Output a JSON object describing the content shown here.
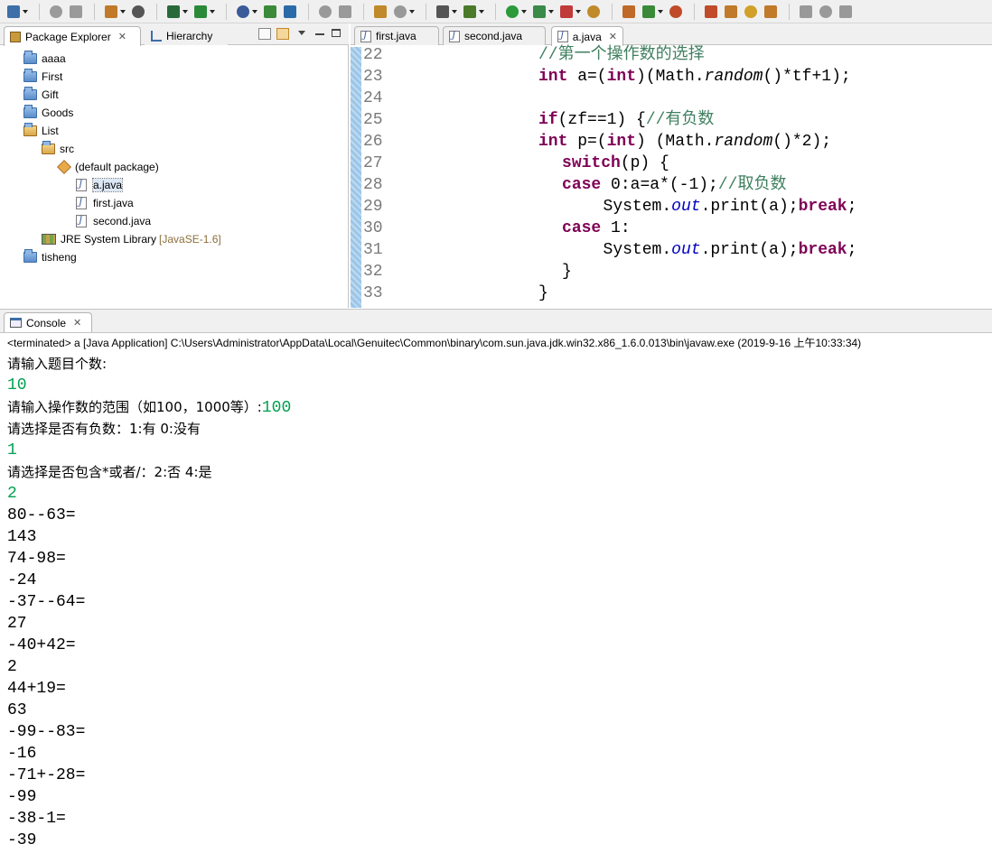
{
  "toolbar": {
    "icons": [
      "new-icon",
      "save-icon",
      "print-icon",
      "tools-icon",
      "access-icon",
      "debug-tool-icon",
      "run-tool-icon",
      "server-icon",
      "deploy-icon",
      "globe-icon",
      "back-icon",
      "fwd-icon",
      "hierarchy-icon",
      "open-icon",
      "camera-icon",
      "bug-icon",
      "run-icon",
      "coverage-icon",
      "external-icon",
      "edit-icon",
      "team-icon",
      "refresh-icon",
      "ant-icon",
      "db-icon",
      "db2-icon",
      "wand-icon",
      "link-icon",
      "pin-icon",
      "min-icon",
      "max-icon"
    ]
  },
  "package_explorer": {
    "tab_label": "Package Explorer",
    "hierarchy_label": "Hierarchy",
    "items": [
      {
        "label": "aaaa",
        "type": "folder",
        "level": 0
      },
      {
        "label": "First",
        "type": "folder",
        "level": 0
      },
      {
        "label": "Gift",
        "type": "folder",
        "level": 0
      },
      {
        "label": "Goods",
        "type": "folder",
        "level": 0
      },
      {
        "label": "List",
        "type": "project",
        "level": 0
      },
      {
        "label": "src",
        "type": "pkgfolder",
        "level": 1
      },
      {
        "label": "(default package)",
        "type": "package",
        "level": 2
      },
      {
        "label": "a.java",
        "type": "java",
        "level": 3,
        "selected": true
      },
      {
        "label": "first.java",
        "type": "java",
        "level": 3
      },
      {
        "label": "second.java",
        "type": "java",
        "level": 3
      },
      {
        "label": "JRE System Library",
        "suffix": "[JavaSE-1.6]",
        "type": "lib",
        "level": 1
      },
      {
        "label": "tisheng",
        "type": "folder",
        "level": 0
      }
    ]
  },
  "editor": {
    "tabs": [
      {
        "label": "first.java",
        "active": false
      },
      {
        "label": "second.java",
        "active": false
      },
      {
        "label": "a.java",
        "active": true
      }
    ],
    "lines": [
      {
        "n": "22",
        "indent": 12,
        "parts": [
          {
            "t": "//第一个操作数的选择",
            "c": "cm"
          }
        ]
      },
      {
        "n": "23",
        "indent": 12,
        "parts": [
          {
            "t": "int",
            "c": "kw"
          },
          {
            "t": " a=("
          },
          {
            "t": "int",
            "c": "kw"
          },
          {
            "t": ")(Math."
          },
          {
            "t": "random",
            "c": "it"
          },
          {
            "t": "()*tf+1);"
          }
        ]
      },
      {
        "n": "24",
        "indent": 0,
        "parts": []
      },
      {
        "n": "25",
        "indent": 12,
        "parts": [
          {
            "t": "if",
            "c": "kw"
          },
          {
            "t": "(zf==1) {"
          },
          {
            "t": "//有负数",
            "c": "cm"
          }
        ]
      },
      {
        "n": "26",
        "indent": 12,
        "parts": [
          {
            "t": "int",
            "c": "kw"
          },
          {
            "t": " p=("
          },
          {
            "t": "int",
            "c": "kw"
          },
          {
            "t": ") (Math."
          },
          {
            "t": "random",
            "c": "it"
          },
          {
            "t": "()*2);"
          }
        ]
      },
      {
        "n": "27",
        "indent": 16,
        "parts": [
          {
            "t": "switch",
            "c": "kw"
          },
          {
            "t": "(p) {"
          }
        ]
      },
      {
        "n": "28",
        "indent": 16,
        "parts": [
          {
            "t": "case",
            "c": "kw"
          },
          {
            "t": " 0:a=a*(-1);"
          },
          {
            "t": "//取负数",
            "c": "cm"
          }
        ]
      },
      {
        "n": "29",
        "indent": 23,
        "parts": [
          {
            "t": "System."
          },
          {
            "t": "out",
            "c": "fld2"
          },
          {
            "t": ".print(a);"
          },
          {
            "t": "break",
            "c": "kw"
          },
          {
            "t": ";"
          }
        ]
      },
      {
        "n": "30",
        "indent": 16,
        "parts": [
          {
            "t": "case",
            "c": "kw"
          },
          {
            "t": " 1:"
          }
        ]
      },
      {
        "n": "31",
        "indent": 23,
        "parts": [
          {
            "t": "System."
          },
          {
            "t": "out",
            "c": "fld2"
          },
          {
            "t": ".print(a);"
          },
          {
            "t": "break",
            "c": "kw"
          },
          {
            "t": ";"
          }
        ]
      },
      {
        "n": "32",
        "indent": 16,
        "parts": [
          {
            "t": "}"
          }
        ]
      },
      {
        "n": "33",
        "indent": 12,
        "parts": [
          {
            "t": "}"
          }
        ]
      }
    ]
  },
  "console": {
    "tab_label": "Console",
    "status": "<terminated> a [Java Application] C:\\Users\\Administrator\\AppData\\Local\\Genuitec\\Common\\binary\\com.sun.java.jdk.win32.x86_1.6.0.013\\bin\\javaw.exe (2019-9-16 上午10:33:34)",
    "lines": [
      [
        {
          "t": "请输入题目个数:"
        }
      ],
      [
        {
          "t": "10",
          "c": "in"
        }
      ],
      [
        {
          "t": "请输入操作数的范围（如100，1000等）:"
        },
        {
          "t": "100",
          "c": "in"
        }
      ],
      [
        {
          "t": "请选择是否有负数：1:有 0:没有"
        }
      ],
      [
        {
          "t": "1",
          "c": "in"
        }
      ],
      [
        {
          "t": "请选择是否包含*或者/：2:否 4:是"
        }
      ],
      [
        {
          "t": "2",
          "c": "in"
        }
      ],
      [
        {
          "t": "80--63="
        }
      ],
      [
        {
          "t": "143"
        }
      ],
      [
        {
          "t": "74-98="
        }
      ],
      [
        {
          "t": "-24"
        }
      ],
      [
        {
          "t": "-37--64="
        }
      ],
      [
        {
          "t": "27"
        }
      ],
      [
        {
          "t": "-40+42="
        }
      ],
      [
        {
          "t": "2"
        }
      ],
      [
        {
          "t": "44+19="
        }
      ],
      [
        {
          "t": "63"
        }
      ],
      [
        {
          "t": "-99--83="
        }
      ],
      [
        {
          "t": "-16"
        }
      ],
      [
        {
          "t": "-71+-28="
        }
      ],
      [
        {
          "t": "-99"
        }
      ],
      [
        {
          "t": "-38-1="
        }
      ],
      [
        {
          "t": "-39"
        }
      ]
    ]
  }
}
